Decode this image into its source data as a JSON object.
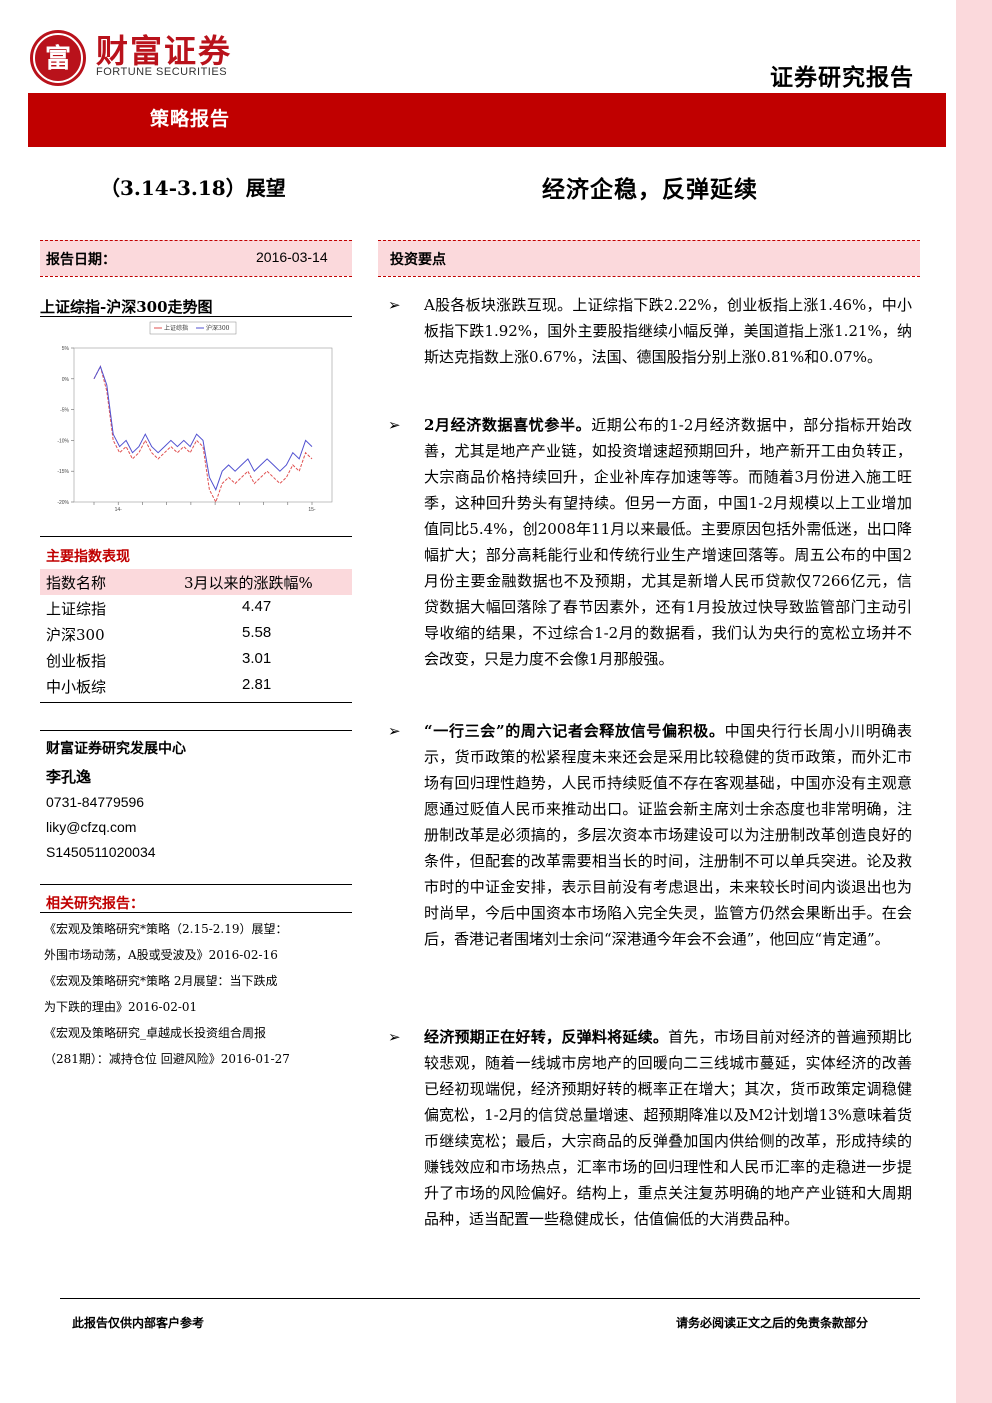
{
  "brand": {
    "name_cn": "财富证券",
    "name_en": "FORTUNE SECURITIES",
    "logo_char": "富",
    "color": "#b9121b"
  },
  "header": {
    "report_type": "证券研究报告",
    "band_label": "策略报告",
    "band_color": "#c00000"
  },
  "title": {
    "week": "（3.14-3.18）展望",
    "headline": "经济企稳，反弹延续"
  },
  "report_date": {
    "label": "报告日期：",
    "value": "2016-03-14"
  },
  "points_heading": "投资要点",
  "chart_title": "上证综指-沪深300走势图",
  "chart_data": {
    "type": "line",
    "title": "",
    "legend": [
      "上证综指",
      "沪深300"
    ],
    "legend_position": "top-center",
    "colors": [
      "#e05050",
      "#5050d0"
    ],
    "ylim": [
      -20,
      5
    ],
    "yticks": [
      "5%",
      "0%",
      "-5%",
      "-10%",
      "-15%",
      "-20%"
    ],
    "xticks": [
      "",
      "14-",
      "",
      "",
      "",
      "",
      "",
      "",
      "",
      "15-"
    ],
    "series": [
      {
        "name": "上证综指",
        "values": [
          0,
          2,
          -2,
          -10,
          -12,
          -11,
          -13,
          -12,
          -10,
          -12,
          -13,
          -12,
          -11,
          -12,
          -11,
          -12,
          -10,
          -11,
          -18,
          -20,
          -17,
          -16,
          -17,
          -16,
          -15,
          -17,
          -16,
          -15,
          -16,
          -17,
          -16,
          -14,
          -15,
          -12,
          -13
        ]
      },
      {
        "name": "沪深300",
        "values": [
          0,
          2,
          -1,
          -9,
          -11,
          -10,
          -12,
          -11,
          -9,
          -11,
          -12,
          -11,
          -10,
          -11,
          -10,
          -11,
          -9,
          -10,
          -16,
          -18,
          -15,
          -14,
          -15,
          -14,
          -13,
          -15,
          -14,
          -13,
          -14,
          -15,
          -14,
          -12,
          -13,
          -10,
          -11
        ]
      }
    ],
    "grid": false
  },
  "index_table": {
    "title": "主要指数表现",
    "header": {
      "name": "指数名称",
      "value": "3月以来的涨跌幅%"
    },
    "rows": [
      {
        "name": "上证综指",
        "value": "4.47"
      },
      {
        "name": "沪深300",
        "value": "5.58"
      },
      {
        "name": "创业板指",
        "value": "3.01"
      },
      {
        "name": "中小板综",
        "value": "2.81"
      }
    ]
  },
  "org": "财富证券研究发展中心",
  "analyst": {
    "name": "李孔逸",
    "phone": "0731-84779596",
    "email": "liky@cfzq.com",
    "cert": "S1450511020034"
  },
  "related": {
    "title": "相关研究报告：",
    "lines": [
      "《宏观及策略研究*策略（2.15-2.19）展望：",
      "外围市场动荡，A股或受波及》2016-02-16",
      "《宏观及策略研究*策略 2月展望：当下跌成",
      "为下跌的理由》2016-02-01",
      "《宏观及策略研究_卓越成长投资组合周报",
      "（281期）：减持仓位 回避风险》2016-01-27"
    ]
  },
  "bullets": [
    {
      "marker": "➢",
      "bold": "",
      "text": "A股各板块涨跌互现。上证综指下跌2.22%，创业板指上涨1.46%，中小板指下跌1.92%，国外主要股指继续小幅反弹，美国道指上涨1.21%，纳斯达克指数上涨0.67%，法国、德国股指分别上涨0.81%和0.07%。"
    },
    {
      "marker": "➢",
      "bold": "2月经济数据喜忧参半。",
      "text": "近期公布的1-2月经济数据中，部分指标开始改善，尤其是地产产业链，如投资增速超预期回升，地产新开工由负转正，大宗商品价格持续回升，企业补库存加速等等。而随着3月份进入施工旺季，这种回升势头有望持续。但另一方面，中国1-2月规模以上工业增加值同比5.4%，创2008年11月以来最低。主要原因包括外需低迷，出口降幅扩大；部分高耗能行业和传统行业生产增速回落等。周五公布的中国2月份主要金融数据也不及预期，尤其是新增人民币贷款仅7266亿元，信贷数据大幅回落除了春节因素外，还有1月投放过快导致监管部门主动引导收缩的结果，不过综合1-2月的数据看，我们认为央行的宽松立场并不会改变，只是力度不会像1月那般强。"
    },
    {
      "marker": "➢",
      "bold": "“一行三会”的周六记者会释放信号偏积极。",
      "text": "中国央行行长周小川明确表示，货币政策的松紧程度未来还会是采用比较稳健的货币政策，而外汇市场有回归理性趋势，人民币持续贬值不存在客观基础，中国亦没有主观意愿通过贬值人民币来推动出口。证监会新主席刘士余态度也非常明确，注册制改革是必须搞的，多层次资本市场建设可以为注册制改革创造良好的条件，但配套的改革需要相当长的时间，注册制不可以单兵突进。论及救市时的中证金安排，表示目前没有考虑退出，未来较长时间内谈退出也为时尚早，今后中国资本市场陷入完全失灵，监管方仍然会果断出手。在会后，香港记者围堵刘士余问“深港通今年会不会通”，他回应“肯定通”。"
    },
    {
      "marker": "➢",
      "bold": "经济预期正在好转，反弹料将延续。",
      "text": "首先，市场目前对经济的普遍预期比较悲观，随着一线城市房地产的回暖向二三线城市蔓延，实体经济的改善已经初现端倪，经济预期好转的概率正在增大；其次，货币政策定调稳健偏宽松，1-2月的信贷总量增速、超预期降准以及M2计划增13%意味着货币继续宽松；最后，大宗商品的反弹叠加国内供给侧的改革，形成持续的赚钱效应和市场热点，汇率市场的回归理性和人民币汇率的走稳进一步提升了市场的风险偏好。结构上，重点关注复苏明确的地产产业链和大周期品种，适当配置一些稳健成长，估值偏低的大消费品种。"
    }
  ],
  "footer": {
    "left": "此报告仅供内部客户参考",
    "right": "请务必阅读正文之后的免责条款部分"
  }
}
